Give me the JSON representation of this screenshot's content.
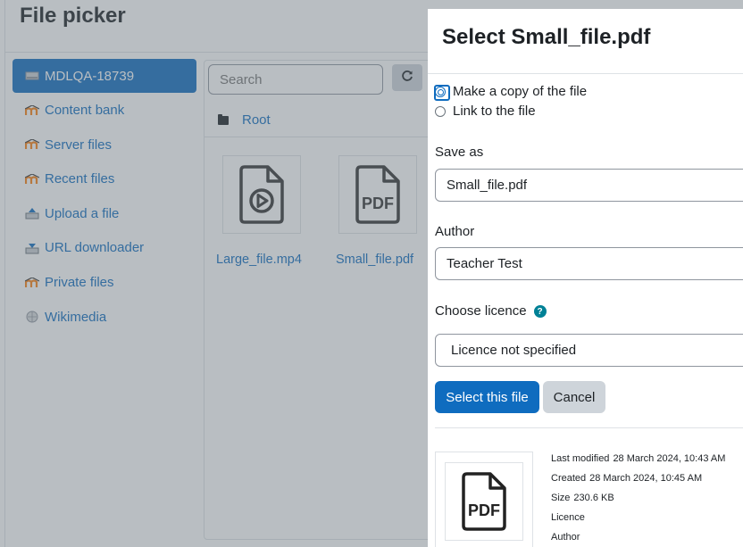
{
  "picker": {
    "title": "File picker",
    "repositories": [
      {
        "label": "MDLQA-18739",
        "icon": "server-icon",
        "active": true
      },
      {
        "label": "Content bank",
        "icon": "moodle-icon"
      },
      {
        "label": "Server files",
        "icon": "moodle-icon"
      },
      {
        "label": "Recent files",
        "icon": "moodle-icon"
      },
      {
        "label": "Upload a file",
        "icon": "upload-icon"
      },
      {
        "label": "URL downloader",
        "icon": "download-icon"
      },
      {
        "label": "Private files",
        "icon": "moodle-icon"
      },
      {
        "label": "Wikimedia",
        "icon": "wikimedia-icon"
      }
    ],
    "search_placeholder": "Search",
    "path_root": "Root",
    "files": [
      {
        "name": "Large_file.mp4",
        "icon": "video-file-icon"
      },
      {
        "name": "Small_file.pdf",
        "icon": "pdf-file-icon"
      }
    ]
  },
  "dialog": {
    "title": "Select Small_file.pdf",
    "option_copy": "Make a copy of the file",
    "option_link": "Link to the file",
    "save_as_label": "Save as",
    "save_as_value": "Small_file.pdf",
    "author_label": "Author",
    "author_value": "Teacher Test",
    "licence_label": "Choose licence",
    "licence_value": "Licence not specified",
    "select_button": "Select this file",
    "cancel_button": "Cancel",
    "thumb_text": "PDF",
    "meta": {
      "modified_label": "Last modified",
      "modified_value": "28 March 2024, 10:43 AM",
      "created_label": "Created",
      "created_value": "28 March 2024, 10:45 AM",
      "size_label": "Size",
      "size_value": "230.6 KB",
      "licence_label": "Licence",
      "author_label": "Author"
    }
  },
  "colors": {
    "primary": "#0f6cbf",
    "secondary": "#ced4da",
    "help": "#008196",
    "moodle_orange": "#f98012"
  }
}
